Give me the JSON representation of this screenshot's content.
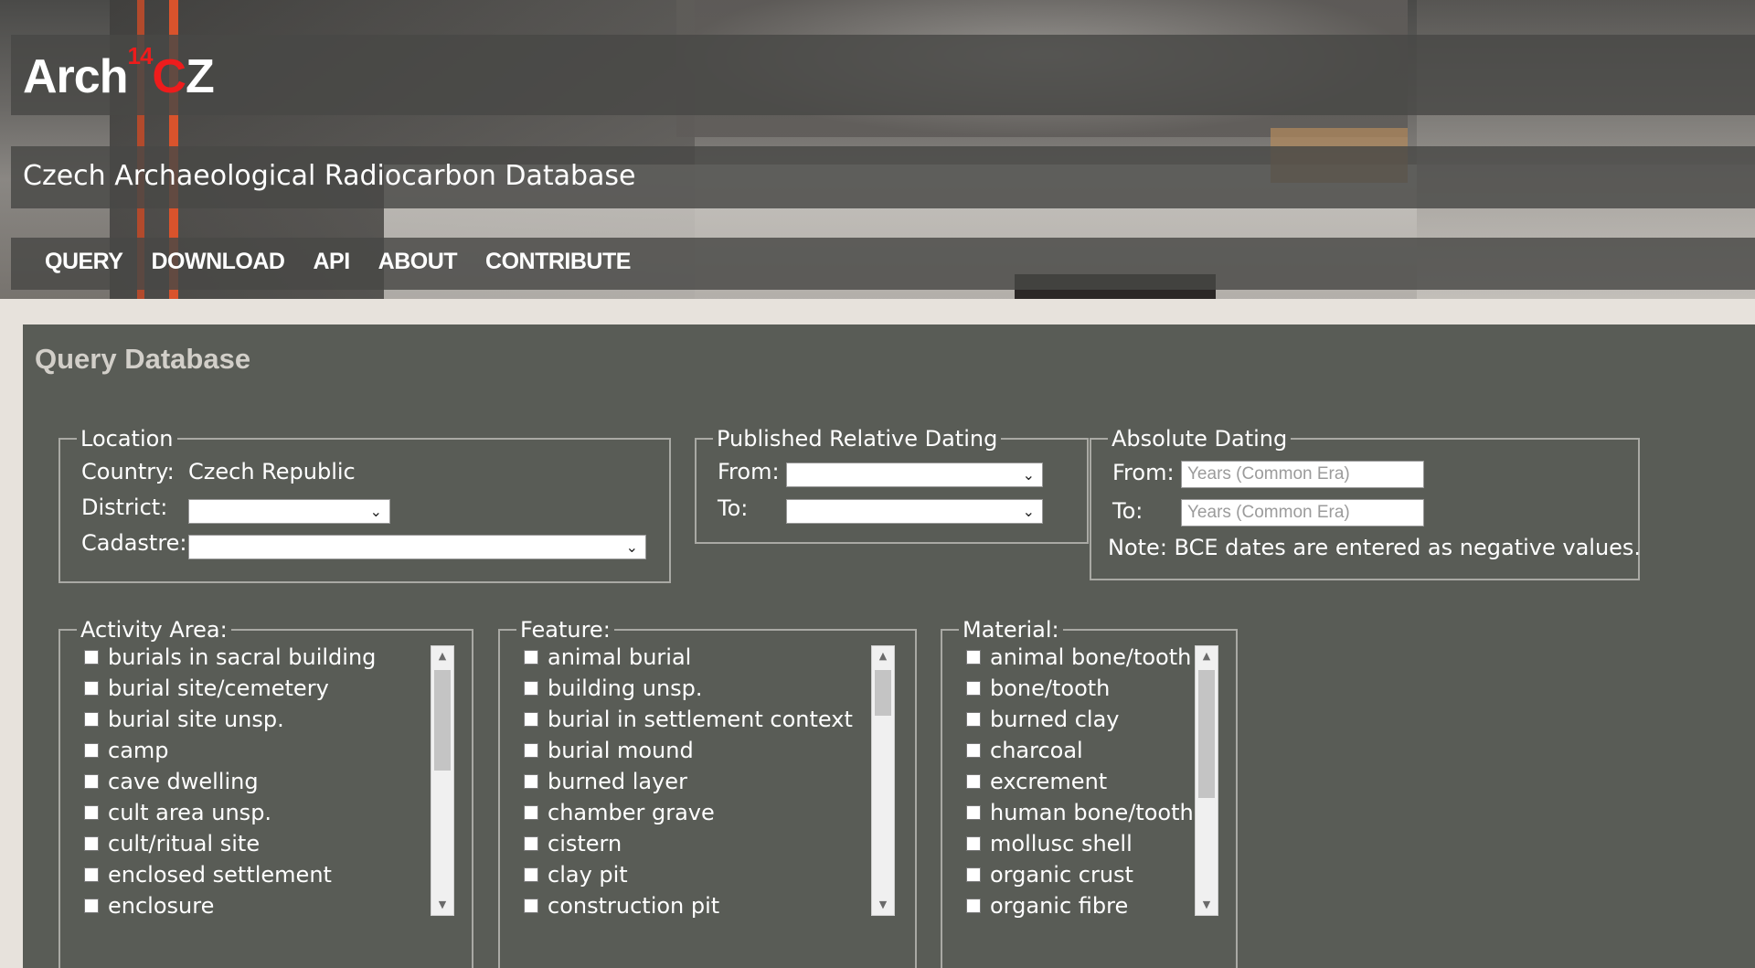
{
  "header": {
    "logo_text": "Arch",
    "logo_sup": "14",
    "logo_red": "C",
    "logo_end": "Z",
    "subtitle": "Czech Archaeological Radiocarbon Database",
    "nav": [
      "QUERY",
      "DOWNLOAD",
      "API",
      "ABOUT",
      "CONTRIBUTE"
    ]
  },
  "panel": {
    "title": "Query Database",
    "location": {
      "legend": "Location",
      "country_label": "Country:",
      "country_value": "Czech Republic",
      "district_label": "District:",
      "cadastre_label": "Cadastre:"
    },
    "relative": {
      "legend": "Published Relative Dating",
      "from_label": "From:",
      "to_label": "To:"
    },
    "absolute": {
      "legend": "Absolute Dating",
      "from_label": "From:",
      "to_label": "To:",
      "placeholder": "Years (Common Era)",
      "note": "Note: BCE dates are entered as negative values."
    },
    "activity": {
      "legend": "Activity Area:",
      "items": [
        "burials in sacral building",
        "burial site/cemetery",
        "burial site unsp.",
        "camp",
        "cave dwelling",
        "cult area unsp.",
        "cult/ritual site",
        "enclosed settlement",
        "enclosure"
      ]
    },
    "feature": {
      "legend": "Feature:",
      "items": [
        "animal burial",
        "building unsp.",
        "burial in settlement context",
        "burial mound",
        "burned layer",
        "chamber grave",
        "cistern",
        "clay pit",
        "construction pit"
      ]
    },
    "material": {
      "legend": "Material:",
      "items": [
        "animal bone/tooth",
        "bone/tooth",
        "burned clay",
        "charcoal",
        "excrement",
        "human bone/tooth",
        "mollusc shell",
        "organic crust",
        "organic fibre"
      ]
    }
  },
  "icons": {
    "chevron": "chevron-down-icon",
    "scroll_up": "scroll-up-arrow-icon",
    "scroll_down": "scroll-down-arrow-icon"
  }
}
